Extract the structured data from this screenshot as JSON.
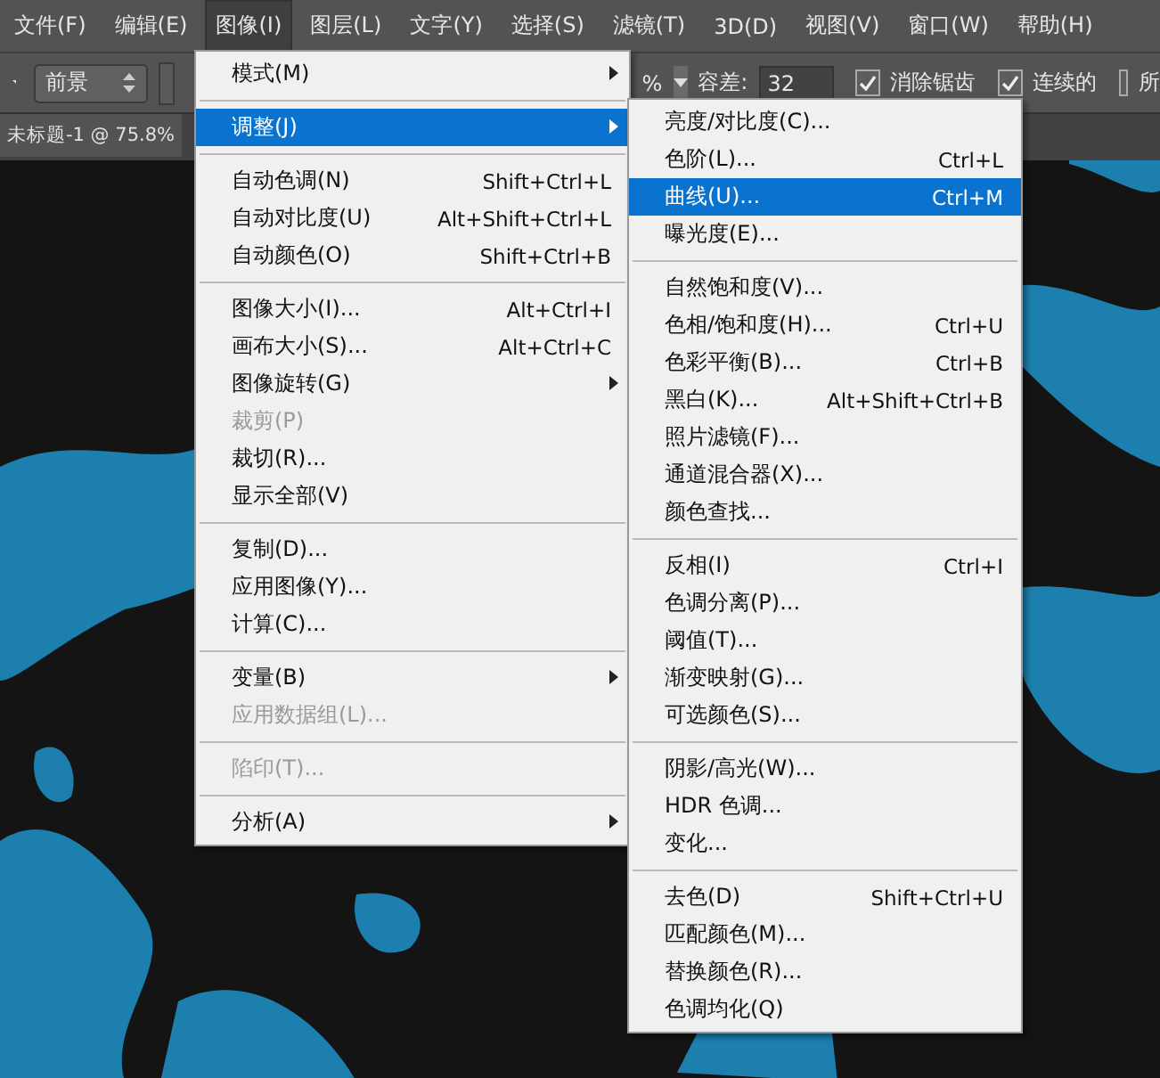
{
  "menubar": [
    {
      "label": "文件(F)",
      "selected": false
    },
    {
      "label": "编辑(E)",
      "selected": false
    },
    {
      "label": "图像(I)",
      "selected": true
    },
    {
      "label": "图层(L)",
      "selected": false
    },
    {
      "label": "文字(Y)",
      "selected": false
    },
    {
      "label": "选择(S)",
      "selected": false
    },
    {
      "label": "滤镜(T)",
      "selected": false
    },
    {
      "label": "3D(D)",
      "selected": false
    },
    {
      "label": "视图(V)",
      "selected": false
    },
    {
      "label": "窗口(W)",
      "selected": false
    },
    {
      "label": "帮助(H)",
      "selected": false
    }
  ],
  "options_bar": {
    "fill_select": "前景",
    "percent": "%",
    "tolerance_label": "容差:",
    "tolerance": "32",
    "checkboxes": [
      {
        "label": "消除锯齿",
        "checked": true
      },
      {
        "label": "连续的",
        "checked": true
      },
      {
        "label": "所",
        "checked": false
      }
    ]
  },
  "document_tab": {
    "title": "未标题-1 @ 75.8%"
  },
  "image_menu": [
    {
      "kind": "item",
      "label": "模式(M)",
      "submenu": true,
      "disabled": false,
      "selected": false
    },
    {
      "kind": "separator"
    },
    {
      "kind": "item",
      "label": "调整(J)",
      "submenu": true,
      "disabled": false,
      "selected": true
    },
    {
      "kind": "separator"
    },
    {
      "kind": "item",
      "label": "自动色调(N)",
      "shortcut": "Shift+Ctrl+L",
      "submenu": false,
      "disabled": false,
      "selected": false
    },
    {
      "kind": "item",
      "label": "自动对比度(U)",
      "shortcut": "Alt+Shift+Ctrl+L",
      "submenu": false,
      "disabled": false,
      "selected": false
    },
    {
      "kind": "item",
      "label": "自动颜色(O)",
      "shortcut": "Shift+Ctrl+B",
      "submenu": false,
      "disabled": false,
      "selected": false
    },
    {
      "kind": "separator"
    },
    {
      "kind": "item",
      "label": "图像大小(I)...",
      "shortcut": "Alt+Ctrl+I",
      "submenu": false,
      "disabled": false,
      "selected": false
    },
    {
      "kind": "item",
      "label": "画布大小(S)...",
      "shortcut": "Alt+Ctrl+C",
      "submenu": false,
      "disabled": false,
      "selected": false
    },
    {
      "kind": "item",
      "label": "图像旋转(G)",
      "submenu": true,
      "disabled": false,
      "selected": false
    },
    {
      "kind": "item",
      "label": "裁剪(P)",
      "submenu": false,
      "disabled": true,
      "selected": false
    },
    {
      "kind": "item",
      "label": "裁切(R)...",
      "submenu": false,
      "disabled": false,
      "selected": false
    },
    {
      "kind": "item",
      "label": "显示全部(V)",
      "submenu": false,
      "disabled": false,
      "selected": false
    },
    {
      "kind": "separator"
    },
    {
      "kind": "item",
      "label": "复制(D)...",
      "submenu": false,
      "disabled": false,
      "selected": false
    },
    {
      "kind": "item",
      "label": "应用图像(Y)...",
      "submenu": false,
      "disabled": false,
      "selected": false
    },
    {
      "kind": "item",
      "label": "计算(C)...",
      "submenu": false,
      "disabled": false,
      "selected": false
    },
    {
      "kind": "separator"
    },
    {
      "kind": "item",
      "label": "变量(B)",
      "submenu": true,
      "disabled": false,
      "selected": false
    },
    {
      "kind": "item",
      "label": "应用数据组(L)...",
      "submenu": false,
      "disabled": true,
      "selected": false
    },
    {
      "kind": "separator"
    },
    {
      "kind": "item",
      "label": "陷印(T)...",
      "submenu": false,
      "disabled": true,
      "selected": false
    },
    {
      "kind": "separator"
    },
    {
      "kind": "item",
      "label": "分析(A)",
      "submenu": true,
      "disabled": false,
      "selected": false
    }
  ],
  "adjust_submenu": [
    {
      "kind": "item",
      "label": "亮度/对比度(C)...",
      "submenu": false,
      "disabled": false,
      "selected": false
    },
    {
      "kind": "item",
      "label": "色阶(L)...",
      "shortcut": "Ctrl+L",
      "submenu": false,
      "disabled": false,
      "selected": false
    },
    {
      "kind": "item",
      "label": "曲线(U)...",
      "shortcut": "Ctrl+M",
      "submenu": false,
      "disabled": false,
      "selected": true
    },
    {
      "kind": "item",
      "label": "曝光度(E)...",
      "submenu": false,
      "disabled": false,
      "selected": false
    },
    {
      "kind": "separator"
    },
    {
      "kind": "item",
      "label": "自然饱和度(V)...",
      "submenu": false,
      "disabled": false,
      "selected": false
    },
    {
      "kind": "item",
      "label": "色相/饱和度(H)...",
      "shortcut": "Ctrl+U",
      "submenu": false,
      "disabled": false,
      "selected": false
    },
    {
      "kind": "item",
      "label": "色彩平衡(B)...",
      "shortcut": "Ctrl+B",
      "submenu": false,
      "disabled": false,
      "selected": false
    },
    {
      "kind": "item",
      "label": "黑白(K)...",
      "shortcut": "Alt+Shift+Ctrl+B",
      "submenu": false,
      "disabled": false,
      "selected": false
    },
    {
      "kind": "item",
      "label": "照片滤镜(F)...",
      "submenu": false,
      "disabled": false,
      "selected": false
    },
    {
      "kind": "item",
      "label": "通道混合器(X)...",
      "submenu": false,
      "disabled": false,
      "selected": false
    },
    {
      "kind": "item",
      "label": "颜色查找...",
      "submenu": false,
      "disabled": false,
      "selected": false
    },
    {
      "kind": "separator"
    },
    {
      "kind": "item",
      "label": "反相(I)",
      "shortcut": "Ctrl+I",
      "submenu": false,
      "disabled": false,
      "selected": false
    },
    {
      "kind": "item",
      "label": "色调分离(P)...",
      "submenu": false,
      "disabled": false,
      "selected": false
    },
    {
      "kind": "item",
      "label": "阈值(T)...",
      "submenu": false,
      "disabled": false,
      "selected": false
    },
    {
      "kind": "item",
      "label": "渐变映射(G)...",
      "submenu": false,
      "disabled": false,
      "selected": false
    },
    {
      "kind": "item",
      "label": "可选颜色(S)...",
      "submenu": false,
      "disabled": false,
      "selected": false
    },
    {
      "kind": "separator"
    },
    {
      "kind": "item",
      "label": "阴影/高光(W)...",
      "submenu": false,
      "disabled": false,
      "selected": false
    },
    {
      "kind": "item",
      "label": "HDR 色调...",
      "submenu": false,
      "disabled": false,
      "selected": false
    },
    {
      "kind": "item",
      "label": "变化...",
      "submenu": false,
      "disabled": false,
      "selected": false
    },
    {
      "kind": "separator"
    },
    {
      "kind": "item",
      "label": "去色(D)",
      "shortcut": "Shift+Ctrl+U",
      "submenu": false,
      "disabled": false,
      "selected": false
    },
    {
      "kind": "item",
      "label": "匹配颜色(M)...",
      "submenu": false,
      "disabled": false,
      "selected": false
    },
    {
      "kind": "item",
      "label": "替换颜色(R)...",
      "submenu": false,
      "disabled": false,
      "selected": false
    },
    {
      "kind": "item",
      "label": "色调均化(Q)",
      "submenu": false,
      "disabled": false,
      "selected": false
    }
  ]
}
